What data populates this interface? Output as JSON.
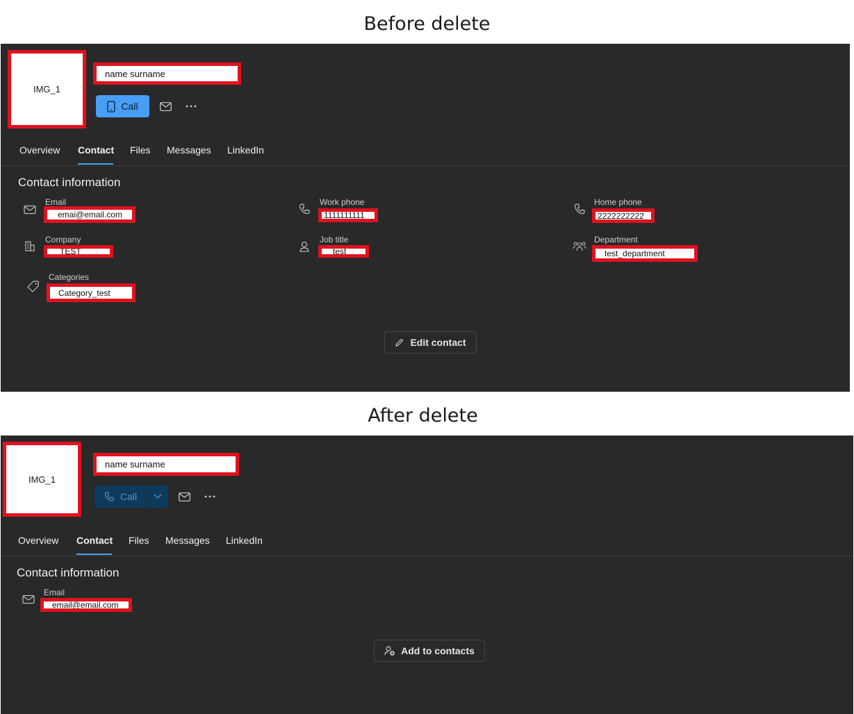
{
  "before": {
    "caption": "Before delete",
    "avatar_text": "IMG_1",
    "name": "name surname",
    "call_label": "Call",
    "tabs": [
      "Overview",
      "Contact",
      "Files",
      "Messages",
      "LinkedIn"
    ],
    "section_title": "Contact information",
    "fields": {
      "email": {
        "label": "Email",
        "value": "emai@email.com"
      },
      "work_phone": {
        "label": "Work phone",
        "value": "1111111111"
      },
      "home_phone": {
        "label": "Home phone",
        "value": "2222222222"
      },
      "company": {
        "label": "Company",
        "value": "TEST"
      },
      "job_title": {
        "label": "Job title",
        "value": "test"
      },
      "department": {
        "label": "Department",
        "value": "test_department"
      },
      "categories": {
        "label": "Categories",
        "value": "Category_test"
      }
    },
    "action_label": "Edit contact"
  },
  "after": {
    "caption": "After delete",
    "avatar_text": "IMG_1",
    "name": "name surname",
    "call_label": "Call",
    "tabs": [
      "Overview",
      "Contact",
      "Files",
      "Messages",
      "LinkedIn"
    ],
    "section_title": "Contact information",
    "fields": {
      "email": {
        "label": "Email",
        "value": "email@email.com"
      }
    },
    "action_label": "Add to contacts"
  },
  "colors": {
    "panel_bg": "#292929",
    "accent": "#4aa3f0",
    "call_active": "#479ef5",
    "call_disabled": "#0c3b5e",
    "redaction": "#e1121f"
  }
}
